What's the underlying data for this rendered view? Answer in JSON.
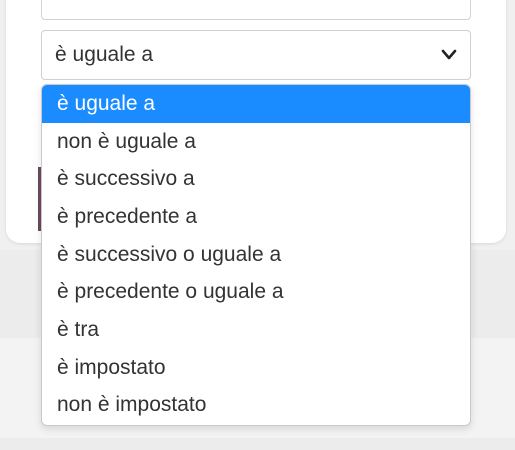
{
  "select": {
    "value": "è uguale a",
    "chevron_icon": "chevron-down-icon"
  },
  "dropdown": {
    "selected_color": "#1a8cff",
    "options": [
      {
        "label": "è uguale a",
        "selected": true
      },
      {
        "label": "non è uguale a",
        "selected": false
      },
      {
        "label": "è successivo a",
        "selected": false
      },
      {
        "label": "è precedente a",
        "selected": false
      },
      {
        "label": "è successivo o uguale a",
        "selected": false
      },
      {
        "label": "è precedente o uguale a",
        "selected": false
      },
      {
        "label": "è tra",
        "selected": false
      },
      {
        "label": "è impostato",
        "selected": false
      },
      {
        "label": "non è impostato",
        "selected": false
      }
    ]
  }
}
